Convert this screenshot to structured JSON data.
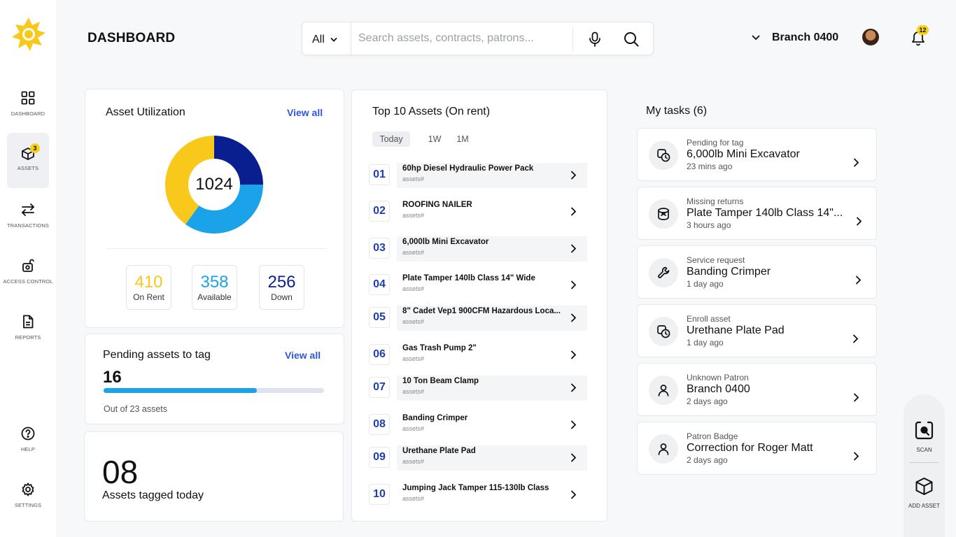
{
  "sidebar": {
    "items": [
      {
        "label": "DASHBOARD"
      },
      {
        "label": "ASSETS",
        "badge": "3"
      },
      {
        "label": "TRANSACTIONS"
      },
      {
        "label": "ACCESS CONTROL"
      },
      {
        "label": "REPORTS"
      },
      {
        "label": "HELP"
      },
      {
        "label": "SETTINGS"
      }
    ]
  },
  "header": {
    "title": "DASHBOARD",
    "search": {
      "filter": "All",
      "placeholder": "Search assets, contracts, patrons..."
    },
    "branch": "Branch 0400",
    "notifications": "12"
  },
  "utilization": {
    "title": "Asset Utilization",
    "view_all": "View all",
    "total": "1024",
    "stats": [
      {
        "value": "410",
        "label": "On Rent",
        "color": "#f8c81a"
      },
      {
        "value": "358",
        "label": "Available",
        "color": "#1aa3e8"
      },
      {
        "value": "256",
        "label": "Down",
        "color": "#0a1f8f"
      }
    ]
  },
  "pending_tag": {
    "title": "Pending assets to tag",
    "view_all": "View all",
    "count": "16",
    "progress": 0.6957,
    "out_of": "Out of 23 assets"
  },
  "tagged_today": {
    "count": "08",
    "label": "Assets tagged today"
  },
  "top_assets": {
    "title": "Top 10 Assets (On rent)",
    "tabs": [
      "Today",
      "1W",
      "1M"
    ],
    "items": [
      {
        "rank": "01",
        "name": "60hp Diesel Hydraulic Power Pack",
        "sub": "assets#"
      },
      {
        "rank": "02",
        "name": "ROOFING NAILER",
        "sub": "assets#"
      },
      {
        "rank": "03",
        "name": "6,000lb Mini Excavator",
        "sub": "assets#"
      },
      {
        "rank": "04",
        "name": "Plate Tamper 140lb Class 14\" Wide",
        "sub": "assets#"
      },
      {
        "rank": "05",
        "name": "8\" Cadet Vep1 900CFM Hazardous Loca...",
        "sub": "assets#"
      },
      {
        "rank": "06",
        "name": "Gas Trash Pump 2\"",
        "sub": "assets#"
      },
      {
        "rank": "07",
        "name": "10 Ton Beam Clamp",
        "sub": "assets#"
      },
      {
        "rank": "08",
        "name": "Banding Crimper",
        "sub": "assets#"
      },
      {
        "rank": "09",
        "name": "Urethane Plate Pad",
        "sub": "assets#"
      },
      {
        "rank": "10",
        "name": "Jumping Jack Tamper 115-130lb Class",
        "sub": "assets#"
      }
    ]
  },
  "tasks": {
    "title": "My tasks (6)",
    "items": [
      {
        "type": "Pending for tag",
        "title": "6,000lb Mini Excavator",
        "time": "23 mins ago",
        "icon": "clock-tag-icon"
      },
      {
        "type": "Missing returns",
        "title": "Plate Tamper 140lb Class 14\"...",
        "time": "3 hours ago",
        "icon": "box-missing-icon"
      },
      {
        "type": "Service request",
        "title": "Banding Crimper",
        "time": "1 day ago",
        "icon": "wrench-icon"
      },
      {
        "type": "Enroll asset",
        "title": "Urethane Plate Pad",
        "time": "1 day ago",
        "icon": "clock-tag-icon"
      },
      {
        "type": "Unknown Patron",
        "title": "Branch 0400",
        "time": "2 days ago",
        "icon": "user-icon"
      },
      {
        "type": "Patron Badge",
        "title": "Correction for Roger Matt",
        "time": "2 days ago",
        "icon": "user-icon"
      }
    ]
  },
  "actions": {
    "scan": "SCAN",
    "add_asset": "ADD ASSET"
  }
}
